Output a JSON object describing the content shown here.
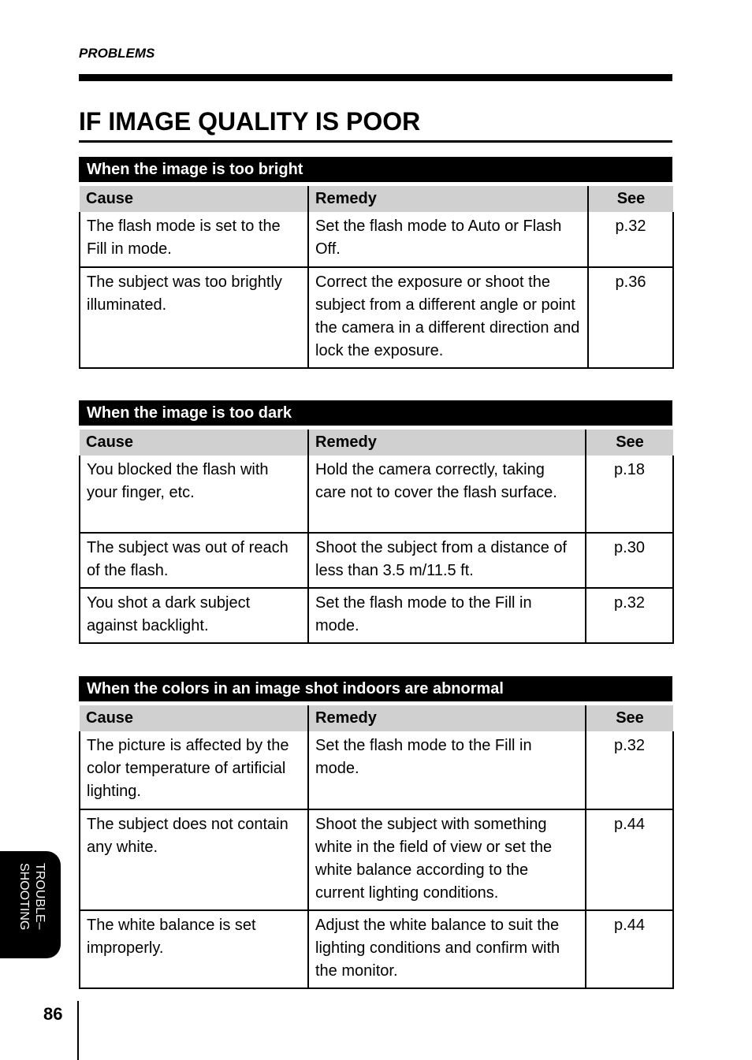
{
  "running_head": "PROBLEMS",
  "title": "IF IMAGE QUALITY IS POOR",
  "columns": {
    "cause": "Cause",
    "remedy": "Remedy",
    "see": "See"
  },
  "sections": [
    {
      "heading": "When the image is too bright",
      "rows": [
        {
          "cause": "The flash mode is set to the Fill in mode.",
          "remedy": "Set the flash mode to Auto or Flash Off.",
          "see": "p.32"
        },
        {
          "cause": "The subject was too brightly illuminated.",
          "remedy": "Correct the exposure or shoot the subject from a different angle or point the camera in a different direction and lock the exposure.",
          "see": "p.36"
        }
      ]
    },
    {
      "heading": "When the image is too dark",
      "rows": [
        {
          "cause": "You blocked the flash with your finger, etc.",
          "remedy": "Hold the camera correctly, taking care not to cover the flash surface.",
          "see": "p.18"
        },
        {
          "cause": "The subject was out of reach of the flash.",
          "remedy": "Shoot the subject from a distance of less than 3.5 m/11.5 ft.",
          "see": "p.30"
        },
        {
          "cause": "You shot a dark subject against backlight.",
          "remedy": "Set the flash mode to the Fill in mode.",
          "see": "p.32"
        }
      ]
    },
    {
      "heading": "When the colors in an image shot indoors are abnormal",
      "rows": [
        {
          "cause": "The picture is affected by the color temperature of artificial lighting.",
          "remedy": "Set the flash mode to the Fill in mode.",
          "see": "p.32"
        },
        {
          "cause": "The subject does not contain any white.",
          "remedy": "Shoot the subject with something white in the field of view or set the white balance according to the current lighting conditions.",
          "see": "p.44"
        },
        {
          "cause": "The white balance is set improperly.",
          "remedy": "Adjust the white balance to suit the lighting conditions and confirm with the monitor.",
          "see": "p.44"
        }
      ]
    }
  ],
  "side_tab": "TROUBLE–\nSHOOTING",
  "side_tab_lines": [
    "TROUBLE–",
    "SHOOTING"
  ],
  "page_number": "86"
}
